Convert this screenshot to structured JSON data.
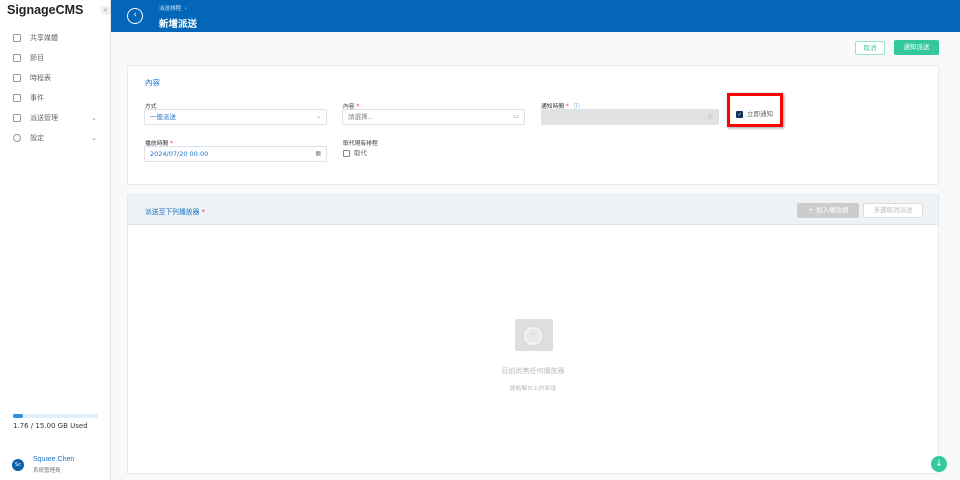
{
  "app": {
    "name": "SignageCMS"
  },
  "sidebar": {
    "items": [
      {
        "label": "共享媒體",
        "icon": "media-icon"
      },
      {
        "label": "節目",
        "icon": "program-icon"
      },
      {
        "label": "時程表",
        "icon": "schedule-icon"
      },
      {
        "label": "事件",
        "icon": "event-icon"
      },
      {
        "label": "派送管理",
        "icon": "rocket-icon",
        "expandable": true
      },
      {
        "label": "設定",
        "icon": "gear-icon",
        "expandable": true
      }
    ],
    "storage": {
      "text": "1.76 / 15.00 GB Used",
      "used_fraction": 0.117
    },
    "user": {
      "initials": "Sc",
      "name": "Square.Chen",
      "role": "系統管理員"
    }
  },
  "header": {
    "breadcrumb": "派送排程",
    "title": "新增派送"
  },
  "actions": {
    "cancel": "取消",
    "notify": "通知派送"
  },
  "form": {
    "section_title": "內容",
    "method": {
      "label": "方式",
      "value": "一般派送"
    },
    "content": {
      "label": "內容",
      "placeholder": "請選擇..."
    },
    "notify_time": {
      "label": "通知時間",
      "value": ""
    },
    "immediate": {
      "label": "立即通知",
      "checked": true
    },
    "play_time": {
      "label": "播放時間",
      "value": "2024/07/20 00:00"
    },
    "replace": {
      "label": "取代現有排程",
      "option": "取代",
      "checked": false
    }
  },
  "players": {
    "title": "派送至下列播放器",
    "add": "加入播放器",
    "multi_cancel": "多選取消派送",
    "empty_title": "目前尚無任何播放器",
    "empty_sub": "請點擊右上的新增"
  },
  "colors": {
    "primary": "#0366b8",
    "accent": "#34c99c",
    "highlight": "#ff0000"
  }
}
